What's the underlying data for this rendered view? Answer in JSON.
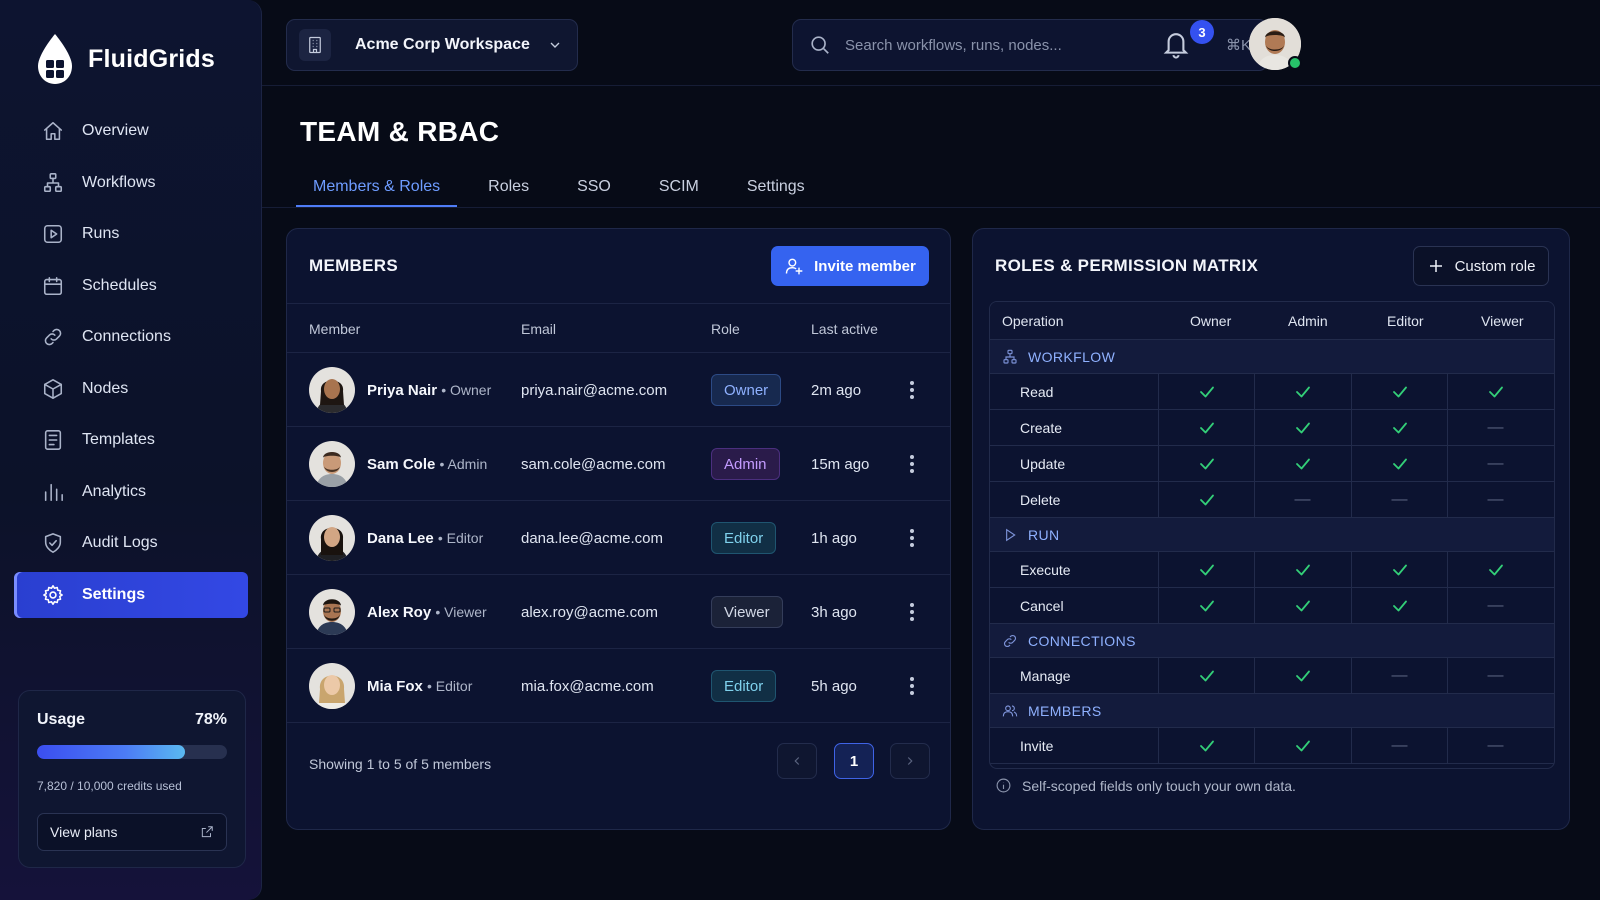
{
  "brand": {
    "name": "FluidGrids"
  },
  "sidebar": {
    "items": [
      {
        "label": "Overview",
        "icon": "home-icon"
      },
      {
        "label": "Workflows",
        "icon": "workflow-icon"
      },
      {
        "label": "Runs",
        "icon": "play-icon"
      },
      {
        "label": "Schedules",
        "icon": "calendar-icon"
      },
      {
        "label": "Connections",
        "icon": "link-icon"
      },
      {
        "label": "Nodes",
        "icon": "cube-icon"
      },
      {
        "label": "Templates",
        "icon": "document-icon"
      },
      {
        "label": "Analytics",
        "icon": "bar-chart-icon"
      },
      {
        "label": "Audit Logs",
        "icon": "shield-icon"
      },
      {
        "label": "Settings",
        "icon": "gear-icon",
        "active": true
      }
    ],
    "usage": {
      "label": "Usage",
      "percent_text": "78%",
      "percent": 0.78,
      "credits_text": "7,820 / 10,000 credits used",
      "view_plans": "View plans"
    }
  },
  "topbar": {
    "workspace": "Acme Corp Workspace",
    "search_placeholder": "Search workflows, runs, nodes...",
    "search_shortcut": "⌘K",
    "notifications_count": "3"
  },
  "page": {
    "title": "TEAM & RBAC",
    "tabs": [
      {
        "label": "Members & Roles",
        "active": true
      },
      {
        "label": "Roles"
      },
      {
        "label": "SSO"
      },
      {
        "label": "SCIM"
      },
      {
        "label": "Settings"
      }
    ]
  },
  "members": {
    "title": "MEMBERS",
    "invite_label": "Invite member",
    "columns": {
      "member": "Member",
      "email": "Email",
      "role": "Role",
      "last_active": "Last active"
    },
    "rows": [
      {
        "name": "Priya Nair",
        "sub": "• Owner",
        "email": "priya.nair@acme.com",
        "role": "Owner",
        "last": "2m ago"
      },
      {
        "name": "Sam Cole",
        "sub": "• Admin",
        "email": "sam.cole@acme.com",
        "role": "Admin",
        "last": "15m ago"
      },
      {
        "name": "Dana Lee",
        "sub": "• Editor",
        "email": "dana.lee@acme.com",
        "role": "Editor",
        "last": "1h ago"
      },
      {
        "name": "Alex Roy",
        "sub": "• Viewer",
        "email": "alex.roy@acme.com",
        "role": "Viewer",
        "last": "3h ago"
      },
      {
        "name": "Mia Fox",
        "sub": "• Editor",
        "email": "mia.fox@acme.com",
        "role": "Editor",
        "last": "5h ago"
      }
    ],
    "footer": "Showing 1 to 5 of 5 members",
    "page": "1"
  },
  "roles": {
    "title": "ROLES & PERMISSION MATRIX",
    "custom_role_label": "Custom role",
    "columns": {
      "operation": "Operation",
      "owner": "Owner",
      "admin": "Admin",
      "editor": "Editor",
      "viewer": "Viewer"
    },
    "groups": [
      {
        "name": "WORKFLOW",
        "icon": "workflow-icon",
        "ops": [
          {
            "op": "Read",
            "perms": [
              true,
              true,
              true,
              true
            ]
          },
          {
            "op": "Create",
            "perms": [
              true,
              true,
              true,
              false
            ]
          },
          {
            "op": "Update",
            "perms": [
              true,
              true,
              true,
              false
            ]
          },
          {
            "op": "Delete",
            "perms": [
              true,
              false,
              false,
              false
            ]
          }
        ]
      },
      {
        "name": "RUN",
        "icon": "play-icon",
        "ops": [
          {
            "op": "Execute",
            "perms": [
              true,
              true,
              true,
              true
            ]
          },
          {
            "op": "Cancel",
            "perms": [
              true,
              true,
              true,
              false
            ]
          }
        ]
      },
      {
        "name": "CONNECTIONS",
        "icon": "link-icon",
        "ops": [
          {
            "op": "Manage",
            "perms": [
              true,
              true,
              false,
              false
            ]
          }
        ]
      },
      {
        "name": "MEMBERS",
        "icon": "users-icon",
        "ops": [
          {
            "op": "Invite",
            "perms": [
              true,
              true,
              false,
              false
            ]
          }
        ]
      }
    ],
    "note": "Self-scoped fields only touch your own data."
  }
}
